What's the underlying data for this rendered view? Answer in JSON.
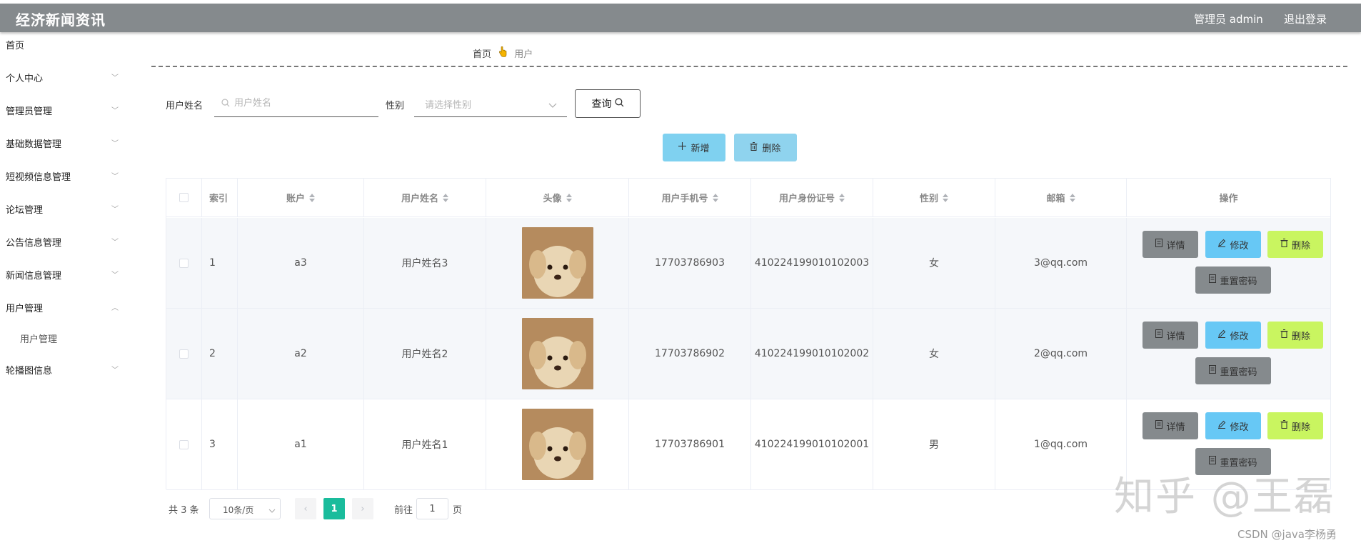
{
  "header": {
    "title": "经济新闻资讯",
    "admin_label": "管理员 admin",
    "logout_label": "退出登录"
  },
  "sidebar": {
    "items": [
      {
        "label": "首页"
      },
      {
        "label": "个人中心"
      },
      {
        "label": "管理员管理"
      },
      {
        "label": "基础数据管理"
      },
      {
        "label": "短视频信息管理"
      },
      {
        "label": "论坛管理"
      },
      {
        "label": "公告信息管理"
      },
      {
        "label": "新闻信息管理"
      },
      {
        "label": "用户管理"
      },
      {
        "label": "轮播图信息"
      }
    ],
    "sub_item": "用户管理"
  },
  "breadcrumb": {
    "home": "首页",
    "current": "用户"
  },
  "search": {
    "name_label": "用户姓名",
    "name_placeholder": "用户姓名",
    "gender_label": "性别",
    "gender_placeholder": "请选择性别",
    "query_label": "查询"
  },
  "actions": {
    "add_label": "新增",
    "delete_label": "删除"
  },
  "table": {
    "columns": [
      "索引",
      "账户",
      "用户姓名",
      "头像",
      "用户手机号",
      "用户身份证号",
      "性别",
      "邮箱",
      "操作"
    ],
    "rows": [
      {
        "index": "1",
        "account": "a3",
        "name": "用户姓名3",
        "phone": "17703786903",
        "id_card": "410224199010102003",
        "gender": "女",
        "email": "3@qq.com"
      },
      {
        "index": "2",
        "account": "a2",
        "name": "用户姓名2",
        "phone": "17703786902",
        "id_card": "410224199010102002",
        "gender": "女",
        "email": "2@qq.com"
      },
      {
        "index": "3",
        "account": "a1",
        "name": "用户姓名1",
        "phone": "17703786901",
        "id_card": "410224199010102001",
        "gender": "男",
        "email": "1@qq.com"
      }
    ],
    "ops": {
      "detail": "详情",
      "edit": "修改",
      "delete": "删除",
      "reset": "重置密码"
    }
  },
  "pagination": {
    "total": "共 3 条",
    "page_size": "10条/页",
    "current_page": "1",
    "goto_label": "前往",
    "goto_value": "1",
    "page_unit": "页"
  },
  "watermarks": {
    "zhihu": "知乎 @王磊",
    "csdn": "CSDN @java李杨勇"
  },
  "colors": {
    "header_bg": "#858a8d",
    "add_button": "#7fd1f0",
    "edit_button": "#67c8f5",
    "delete_button": "#c9f560",
    "detail_button": "#858a8d",
    "active_page": "#1abc9c"
  }
}
